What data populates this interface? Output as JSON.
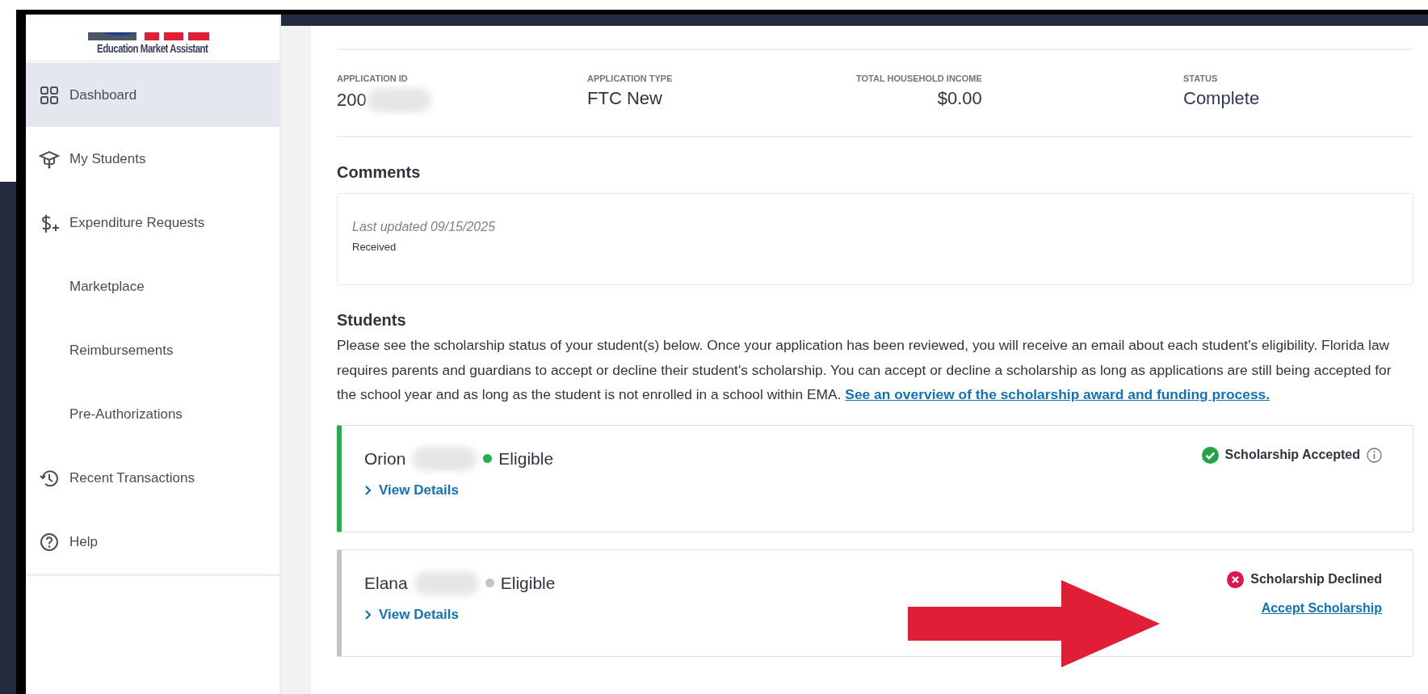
{
  "sidebar": {
    "logo_text": "Education Market Assistant",
    "items": [
      {
        "label": "Dashboard",
        "kind": "grid",
        "selected": true
      },
      {
        "label": "My Students",
        "kind": "cap",
        "selected": false
      },
      {
        "label": "Expenditure Requests",
        "kind": "dollar",
        "selected": false
      },
      {
        "label": "Marketplace",
        "kind": "none",
        "selected": false
      },
      {
        "label": "Reimbursements",
        "kind": "none",
        "selected": false
      },
      {
        "label": "Pre-Authorizations",
        "kind": "none",
        "selected": false
      },
      {
        "label": "Recent Transactions",
        "kind": "history",
        "selected": false
      },
      {
        "label": "Help",
        "kind": "help",
        "selected": false
      }
    ]
  },
  "summary": [
    {
      "label": "APPLICATION ID",
      "value": "200",
      "redacted": true,
      "kind": "text"
    },
    {
      "label": "APPLICATION TYPE",
      "value": "FTC New",
      "redacted": false,
      "kind": "text"
    },
    {
      "label": "TOTAL HOUSEHOLD INCOME",
      "value": "$0.00",
      "redacted": false,
      "kind": "amount"
    },
    {
      "label": "STATUS",
      "value": "Complete",
      "redacted": false,
      "kind": "text"
    }
  ],
  "comments": {
    "title": "Comments",
    "updated": "Last updated 09/15/2025",
    "text": "Received"
  },
  "students": {
    "title": "Students",
    "description": "Please see the scholarship status of your student(s) below. Once your application has been reviewed, you will receive an email about each student's eligibility. Florida law requires parents and guardians to accept or decline their student's scholarship. You can accept or decline a scholarship as long as applications are still being accepted for the school year and as long as the student is not enrolled in a school within EMA.",
    "link": "See an overview of the scholarship award and funding process.",
    "cards": [
      {
        "name": "Orion",
        "redacted": true,
        "eligibility": "Eligible",
        "color": "#22b04b",
        "details": "View Details",
        "status": "Scholarship Accepted",
        "kind": "accepted",
        "info": true
      },
      {
        "name": "Elana",
        "redacted": true,
        "eligibility": "Eligible",
        "color": "#c4c4c4",
        "details": "View Details",
        "status": "Scholarship Declined",
        "kind": "declined",
        "info": false,
        "action": "Accept Scholarship"
      }
    ]
  }
}
